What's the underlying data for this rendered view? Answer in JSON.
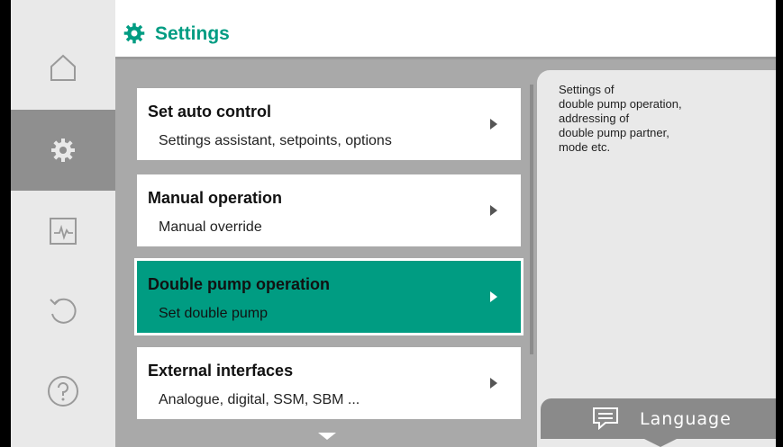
{
  "header": {
    "title": "Settings",
    "icon": "gear-icon",
    "accent_color": "#009c82"
  },
  "sidebar": {
    "items": [
      {
        "name": "home",
        "icon": "home-icon"
      },
      {
        "name": "settings",
        "icon": "gear-icon",
        "active": true
      },
      {
        "name": "diagnostics",
        "icon": "pulse-icon"
      },
      {
        "name": "restore",
        "icon": "undo-icon"
      },
      {
        "name": "help",
        "icon": "help-icon"
      }
    ]
  },
  "menu": {
    "items": [
      {
        "title": "Set auto control",
        "subtitle": "Settings assistant, setpoints, options"
      },
      {
        "title": "Manual operation",
        "subtitle": "Manual override"
      },
      {
        "title": "Double pump operation",
        "subtitle": "Set double pump",
        "selected": true
      },
      {
        "title": "External interfaces",
        "subtitle": "Analogue, digital, SSM, SBM ..."
      }
    ]
  },
  "help_panel": {
    "text": "Settings of\ndouble pump operation,\naddressing of\ndouble pump partner,\nmode etc."
  },
  "language_button": {
    "label": "Language",
    "icon": "speech-bubble-icon"
  }
}
